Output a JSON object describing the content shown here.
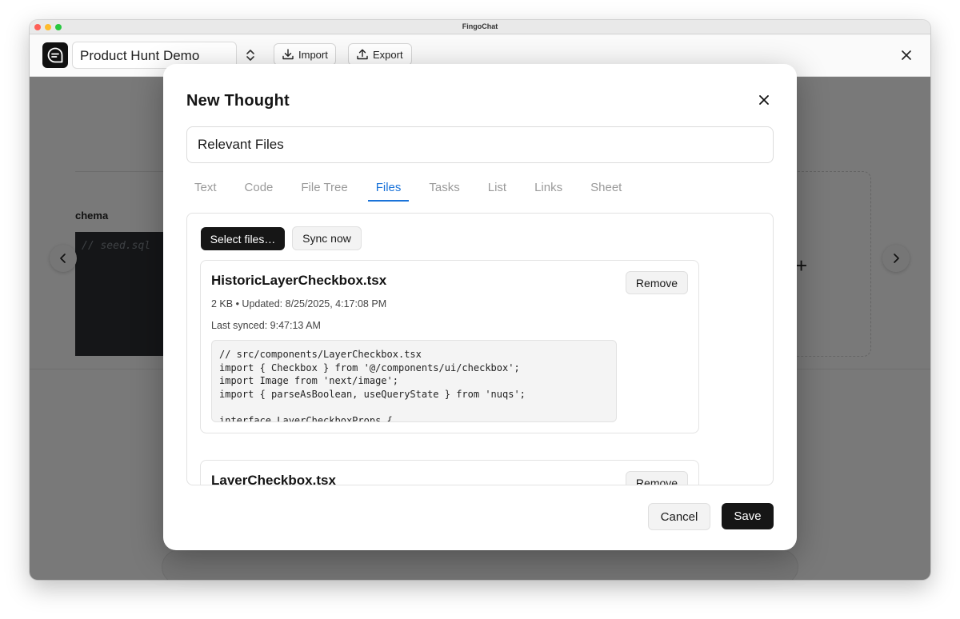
{
  "window": {
    "title": "FingoChat"
  },
  "toolbar": {
    "project_name": "Product Hunt Demo",
    "import_label": "Import",
    "export_label": "Export"
  },
  "background": {
    "card_label": "chema",
    "code_comment": "// seed.sql"
  },
  "modal": {
    "title": "New Thought",
    "title_value": "Relevant Files",
    "tabs": [
      {
        "label": "Text"
      },
      {
        "label": "Code"
      },
      {
        "label": "File Tree"
      },
      {
        "label": "Files"
      },
      {
        "label": "Tasks"
      },
      {
        "label": "List"
      },
      {
        "label": "Links"
      },
      {
        "label": "Sheet"
      }
    ],
    "active_tab": "Files",
    "select_files_label": "Select files…",
    "sync_now_label": "Sync now",
    "files": [
      {
        "name": "HistoricLayerCheckbox.tsx",
        "remove_label": "Remove",
        "meta": "2 KB • Updated: 8/25/2025, 4:17:08 PM",
        "synced": "Last synced: 9:47:13 AM",
        "code": [
          "// src/components/LayerCheckbox.tsx",
          "import { Checkbox } from '@/components/ui/checkbox';",
          "import Image from 'next/image';",
          "import { parseAsBoolean, useQueryState } from 'nuqs';",
          "",
          "interface LayerCheckboxProps {"
        ]
      },
      {
        "name": "LayerCheckbox.tsx",
        "remove_label": "Remove"
      }
    ],
    "cancel_label": "Cancel",
    "save_label": "Save"
  }
}
